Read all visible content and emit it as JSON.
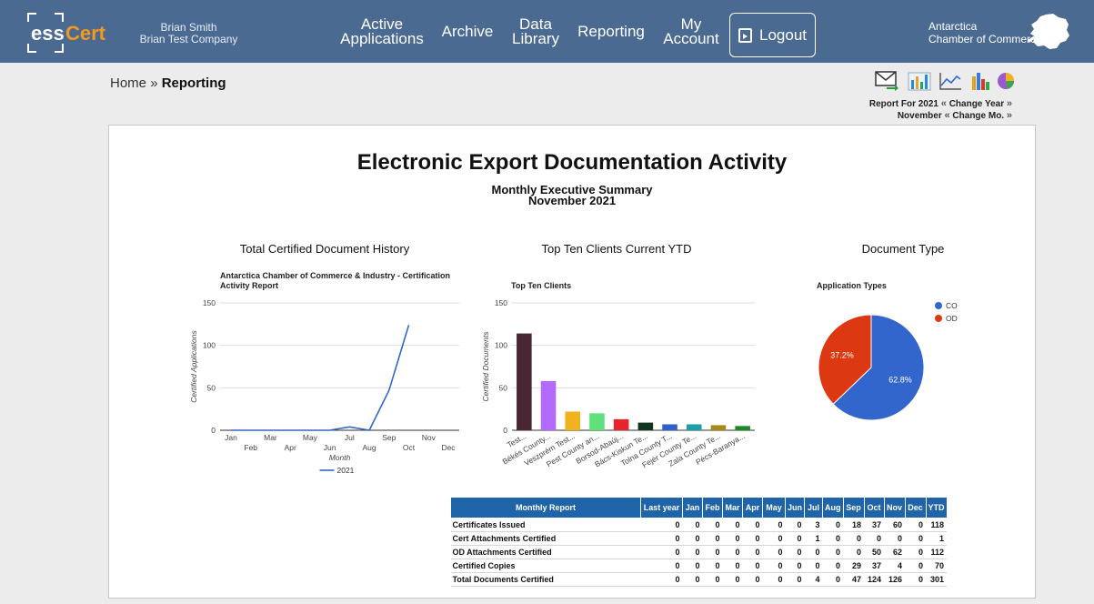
{
  "header": {
    "logo": {
      "part1": "ess",
      "part2": "Cert"
    },
    "user_name": "Brian Smith",
    "user_company": "Brian Test Company",
    "nav": [
      {
        "label": "Active\nApplications"
      },
      {
        "label": "Archive"
      },
      {
        "label": "Data\nLibrary"
      },
      {
        "label": "Reporting"
      },
      {
        "label": "My\nAccount"
      }
    ],
    "logout": "Logout",
    "chamber_line1": "Antarctica",
    "chamber_line2": "Chamber of Commerce"
  },
  "breadcrumb": {
    "home": "Home",
    "sep": "»",
    "current": "Reporting"
  },
  "toolbar": {
    "icons": [
      "email-report-icon",
      "bar-chart-icon",
      "line-chart-icon",
      "column-chart-icon",
      "pie-chart-icon"
    ],
    "report_for_label": "Report For 2021",
    "change_year": "Change Year",
    "month_label": "November",
    "change_month": "Change Mo.",
    "prev": "«",
    "next": "»"
  },
  "report": {
    "title": "Electronic Export Documentation Activity",
    "subtitle": "Monthly Executive Summary",
    "subtitle_period": "November 2021",
    "section_history": "Total Certified Document History",
    "section_clients": "Top Ten Clients Current YTD",
    "section_doctype": "Document Type"
  },
  "chart_data": [
    {
      "type": "line",
      "title": "Antarctica Chamber of Commerce & Industry - Certification Activity Report",
      "xlabel": "Month",
      "ylabel": "Certified Applications",
      "categories": [
        "Jan",
        "Feb",
        "Mar",
        "Apr",
        "May",
        "Jun",
        "Jul",
        "Aug",
        "Sep",
        "Oct",
        "Nov",
        "Dec"
      ],
      "series": [
        {
          "name": "2021",
          "values": [
            0,
            0,
            0,
            0,
            0,
            0,
            4,
            0,
            47,
            124,
            null,
            null
          ],
          "color": "#3366cc"
        }
      ],
      "ylim": [
        0,
        150
      ],
      "yticks": [
        0,
        50,
        100,
        150
      ],
      "grid": true,
      "legend": "bottom"
    },
    {
      "type": "bar",
      "title": "Top Ten Clients",
      "ylabel": "Certified Documents",
      "categories": [
        "Test...",
        "Békés County...",
        "Veszprém Test...",
        "Pest County an...",
        "Borsod-Abaúj...",
        "Bács-Kiskun Te...",
        "Tolna County T...",
        "Fejér County Te...",
        "Zala County Te...",
        "Pécs-Baranya..."
      ],
      "values": [
        114,
        58,
        22,
        20,
        13,
        9,
        7,
        7,
        6,
        5
      ],
      "colors": [
        "#4a2635",
        "#b36bff",
        "#f0b21f",
        "#5fe07a",
        "#e8242b",
        "#10361e",
        "#3060c8",
        "#1aa0a8",
        "#a88a18",
        "#1a8a28"
      ],
      "ylim": [
        0,
        150
      ],
      "yticks": [
        0,
        50,
        100,
        150
      ],
      "grid": true
    },
    {
      "type": "pie",
      "title": "Application Types",
      "slices": [
        {
          "label": "CO",
          "value": 62.8,
          "color": "#3366cc"
        },
        {
          "label": "OD",
          "value": 37.2,
          "color": "#dc3912"
        }
      ],
      "legend": "top-right"
    }
  ],
  "table": {
    "headers": [
      "Monthly Report",
      "Last year",
      "Jan",
      "Feb",
      "Mar",
      "Apr",
      "May",
      "Jun",
      "Jul",
      "Aug",
      "Sep",
      "Oct",
      "Nov",
      "Dec",
      "YTD"
    ],
    "rows": [
      {
        "label": "Certificates Issued",
        "values": [
          "0",
          "0",
          "0",
          "0",
          "0",
          "0",
          "0",
          "3",
          "0",
          "18",
          "37",
          "60",
          "0",
          "118"
        ]
      },
      {
        "label": "Cert Attachments Certified",
        "values": [
          "0",
          "0",
          "0",
          "0",
          "0",
          "0",
          "0",
          "1",
          "0",
          "0",
          "0",
          "0",
          "0",
          "1"
        ]
      },
      {
        "label": "OD Attachments Certified",
        "values": [
          "0",
          "0",
          "0",
          "0",
          "0",
          "0",
          "0",
          "0",
          "0",
          "0",
          "50",
          "62",
          "0",
          "112"
        ]
      },
      {
        "label": "Certified Copies",
        "values": [
          "0",
          "0",
          "0",
          "0",
          "0",
          "0",
          "0",
          "0",
          "0",
          "29",
          "37",
          "4",
          "0",
          "70"
        ]
      },
      {
        "label": "Total Documents Certified",
        "values": [
          "0",
          "0",
          "0",
          "0",
          "0",
          "0",
          "0",
          "4",
          "0",
          "47",
          "124",
          "126",
          "0",
          "301"
        ]
      }
    ]
  }
}
